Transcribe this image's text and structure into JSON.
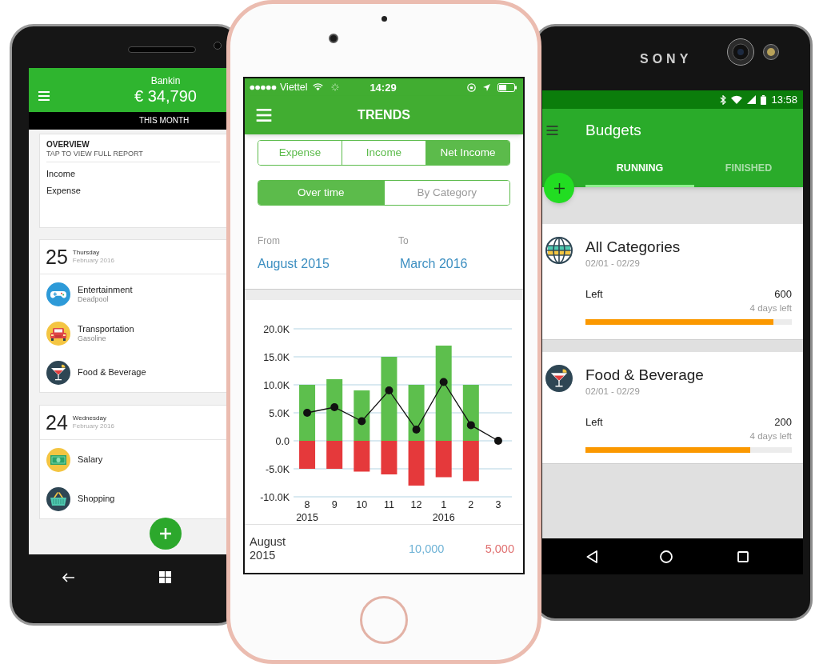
{
  "left_phone": {
    "header": {
      "title": "Bankin",
      "balance": "€ 34,790"
    },
    "period": "THIS MONTH",
    "overview": {
      "title": "OVERVIEW",
      "subtitle": "TAP TO VIEW FULL REPORT",
      "rows": [
        "Income",
        "Expense"
      ]
    },
    "days": [
      {
        "day": "25",
        "weekday": "Thursday",
        "month": "February 2016",
        "transactions": [
          {
            "kind": "entertainment",
            "category": "Entertainment",
            "note": "Deadpool"
          },
          {
            "kind": "transportation",
            "category": "Transportation",
            "note": "Gasoline"
          },
          {
            "kind": "food",
            "category": "Food & Beverage"
          }
        ]
      },
      {
        "day": "24",
        "weekday": "Wednesday",
        "month": "February 2016",
        "transactions": [
          {
            "kind": "salary",
            "category": "Salary"
          },
          {
            "kind": "shopping",
            "category": "Shopping"
          }
        ]
      }
    ]
  },
  "center_phone": {
    "status_bar": {
      "carrier": "Viettel",
      "time": "14:29"
    },
    "title": "TRENDS",
    "type_tabs": [
      {
        "label": "Expense",
        "selected": false
      },
      {
        "label": "Income",
        "selected": false
      },
      {
        "label": "Net Income",
        "selected": true
      }
    ],
    "view_tabs": [
      {
        "label": "Over time",
        "selected": true
      },
      {
        "label": "By Category",
        "selected": false
      }
    ],
    "range": {
      "from_label": "From",
      "from": "August 2015",
      "to_label": "To",
      "to": "March 2016"
    },
    "chart_data": {
      "type": "bar",
      "stacked": true,
      "grid": true,
      "categories": [
        "8",
        "9",
        "10",
        "11",
        "12",
        "1",
        "2",
        "3"
      ],
      "series": [
        {
          "type": "bar",
          "color": "#5dbf4d",
          "values": [
            10000,
            11000,
            9000,
            15000,
            10000,
            17000,
            10000,
            0
          ]
        },
        {
          "type": "bar",
          "color": "#e5393b",
          "values": [
            -5000,
            -5000,
            -5500,
            -6000,
            -8000,
            -6500,
            -7200,
            0
          ]
        },
        {
          "type": "line",
          "marker": "circle",
          "color": "#111111",
          "values": [
            5000,
            6000,
            3500,
            9000,
            2000,
            10500,
            2800,
            0
          ]
        }
      ],
      "ylim": [
        -10000,
        20000
      ],
      "yticks": [
        {
          "value": 20000,
          "label": "20.0K"
        },
        {
          "value": 15000,
          "label": "15.0K"
        },
        {
          "value": 10000,
          "label": "10.0K"
        },
        {
          "value": 5000,
          "label": "5.0K"
        },
        {
          "value": 0,
          "label": "0.0"
        },
        {
          "value": -5000,
          "label": "-5.0K"
        },
        {
          "value": -10000,
          "label": "-10.0K"
        }
      ],
      "annotations": [
        "2015",
        "2016"
      ]
    },
    "summary": {
      "period": "August 2015",
      "income": "10,000",
      "expense": "5,000"
    }
  },
  "right_phone": {
    "brand": "SONY",
    "status_bar": {
      "time": "13:58"
    },
    "title": "Budgets",
    "tabs": [
      {
        "label": "RUNNING",
        "selected": true
      },
      {
        "label": "FINISHED",
        "selected": false
      }
    ],
    "budgets": [
      {
        "kind": "all",
        "name": "All Categories",
        "dates": "02/01 - 02/29",
        "label": "Left",
        "amount": "600",
        "remaining": "4 days left",
        "level": 0.91
      },
      {
        "kind": "food",
        "name": "Food & Beverage",
        "dates": "02/01 - 02/29",
        "label": "Left",
        "amount": "200",
        "remaining": "4 days left",
        "level": 0.8
      }
    ]
  }
}
